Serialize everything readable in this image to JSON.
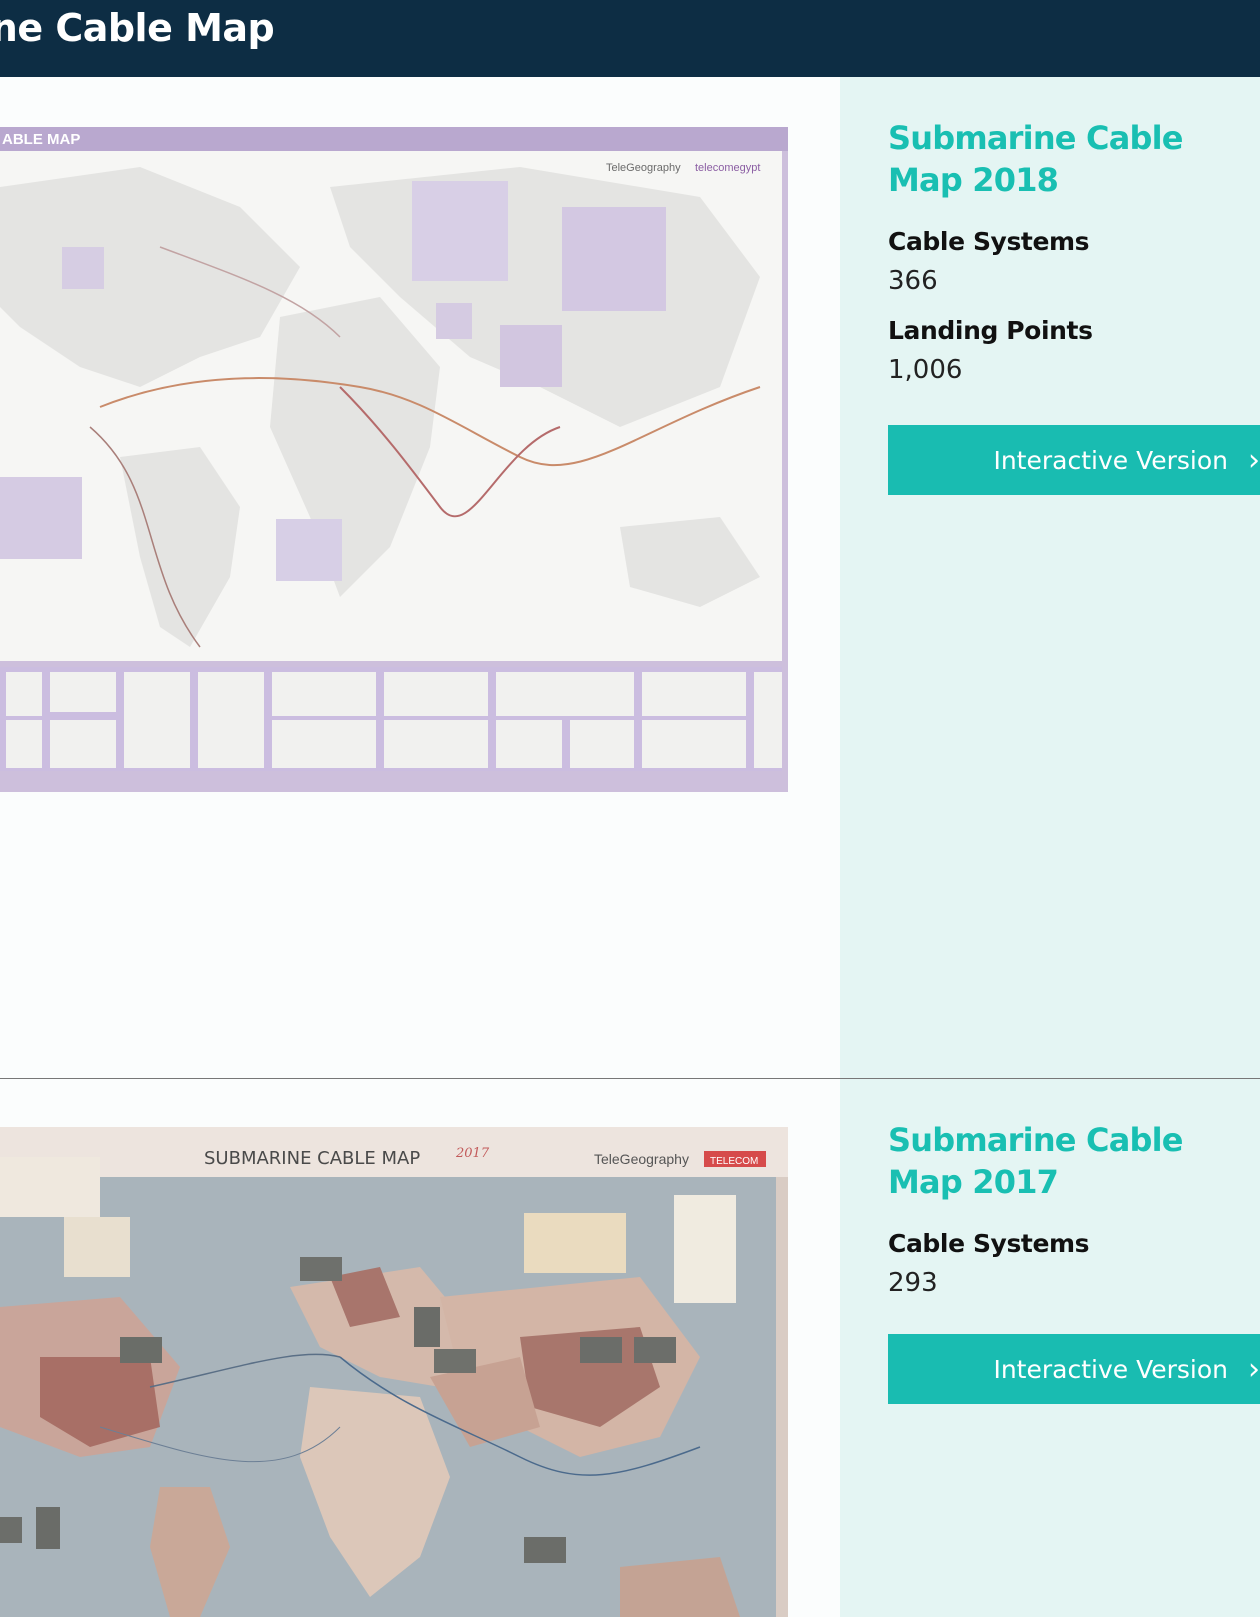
{
  "header": {
    "title": "rine Cable Map"
  },
  "maps": [
    {
      "title": "Submarine Cable Map 2018",
      "stats": [
        {
          "label": "Cable Systems",
          "value": "366"
        },
        {
          "label": "Landing Points",
          "value": "1,006"
        }
      ],
      "cta_label": "Interactive Version",
      "thumbnail": {
        "banner": "ABLE MAP",
        "logo_left": "TeleGeography",
        "logo_right": "telecomegypt"
      }
    },
    {
      "title": "Submarine Cable Map 2017",
      "stats": [
        {
          "label": "Cable Systems",
          "value": "293"
        }
      ],
      "cta_label": "Interactive Version",
      "thumbnail": {
        "banner": "SUBMARINE  CABLE  MAP",
        "year": "2017",
        "logo_left": "TeleGeography",
        "logo_right": "TELECOM"
      }
    }
  ],
  "icons": {
    "cta_arrow": "chevron-right-icon"
  },
  "colors": {
    "header_bg": "#0d2d44",
    "accent": "#19bfb2",
    "panel_bg": "#e4f5f3"
  }
}
